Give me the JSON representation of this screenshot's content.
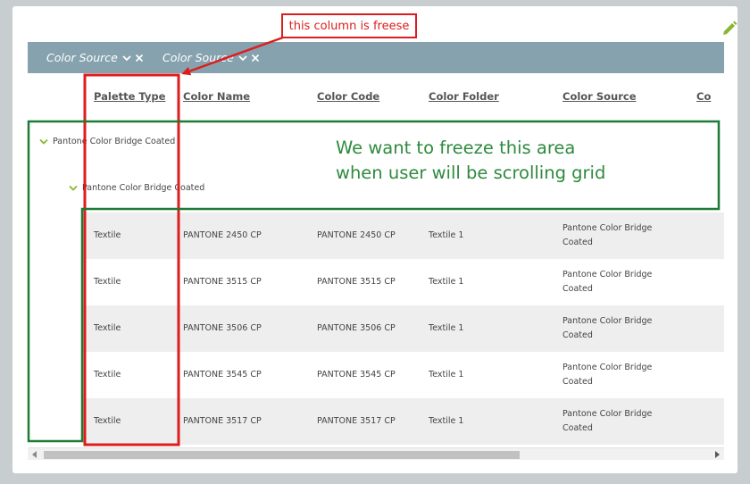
{
  "toolbar": {
    "edit_icon": "pencil-icon"
  },
  "group_chips": [
    {
      "label": "Color Source"
    },
    {
      "label": "Color Source"
    }
  ],
  "columns": [
    "Palette Type",
    "Color Name",
    "Color Code",
    "Color Folder",
    "Color Source",
    "Co"
  ],
  "groups": [
    {
      "label": "Pantone Color Bridge Coated"
    },
    {
      "label": "Pantone Color Bridge Coated"
    }
  ],
  "rows": [
    {
      "palette_type": "Textile",
      "color_name": "PANTONE 2450 CP",
      "color_code": "PANTONE 2450 CP",
      "color_folder": "Textile 1",
      "color_source_1": "Pantone Color Bridge",
      "color_source_2": "Coated"
    },
    {
      "palette_type": "Textile",
      "color_name": "PANTONE 3515 CP",
      "color_code": "PANTONE 3515 CP",
      "color_folder": "Textile 1",
      "color_source_1": "Pantone Color Bridge",
      "color_source_2": "Coated"
    },
    {
      "palette_type": "Textile",
      "color_name": "PANTONE 3506 CP",
      "color_code": "PANTONE 3506 CP",
      "color_folder": "Textile 1",
      "color_source_1": "Pantone Color Bridge",
      "color_source_2": "Coated"
    },
    {
      "palette_type": "Textile",
      "color_name": "PANTONE 3545 CP",
      "color_code": "PANTONE 3545 CP",
      "color_folder": "Textile 1",
      "color_source_1": "Pantone Color Bridge",
      "color_source_2": "Coated"
    },
    {
      "palette_type": "Textile",
      "color_name": "PANTONE 3517 CP",
      "color_code": "PANTONE 3517 CP",
      "color_folder": "Textile 1",
      "color_source_1": "Pantone Color Bridge",
      "color_source_2": "Coated"
    }
  ],
  "annotations": {
    "callout": "this column is freese",
    "note_line1": "We want to freeze this area",
    "note_line2": "when user will be scrolling grid"
  },
  "colors": {
    "group_bar": "#86a2ae",
    "alt_row": "#eeeeee",
    "annotation_red": "#dd1d1d",
    "annotation_green": "#1e7a35",
    "accent_green": "#8ab633"
  }
}
